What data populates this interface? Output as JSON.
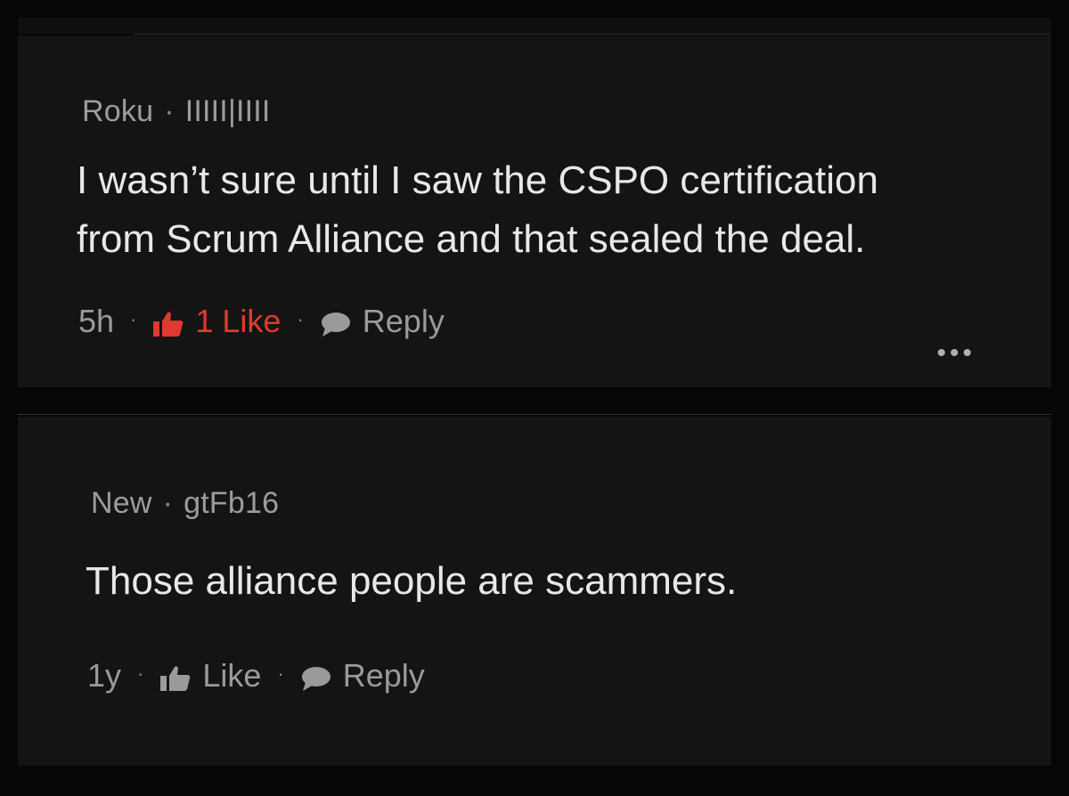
{
  "comments": [
    {
      "author": "Roku",
      "handle": "IIIII|IIII",
      "text_line1": "I wasn’t sure until I saw the CSPO certification",
      "text_line2": "from Scrum Alliance and that sealed the deal.",
      "age": "5h",
      "like_label": "1 Like",
      "reply_label": "Reply",
      "liked": true,
      "like_color": "#e0392f"
    },
    {
      "author": "New",
      "handle": "gtFb16",
      "text_line1": "Those alliance people are scammers.",
      "age": "1y",
      "like_label": "Like",
      "reply_label": "Reply",
      "liked": false
    }
  ],
  "separator": "·",
  "more_label": "•••",
  "icons": {
    "like": "thumbs-up-icon",
    "reply": "speech-bubble-icon",
    "more": "more-horizontal-icon"
  }
}
